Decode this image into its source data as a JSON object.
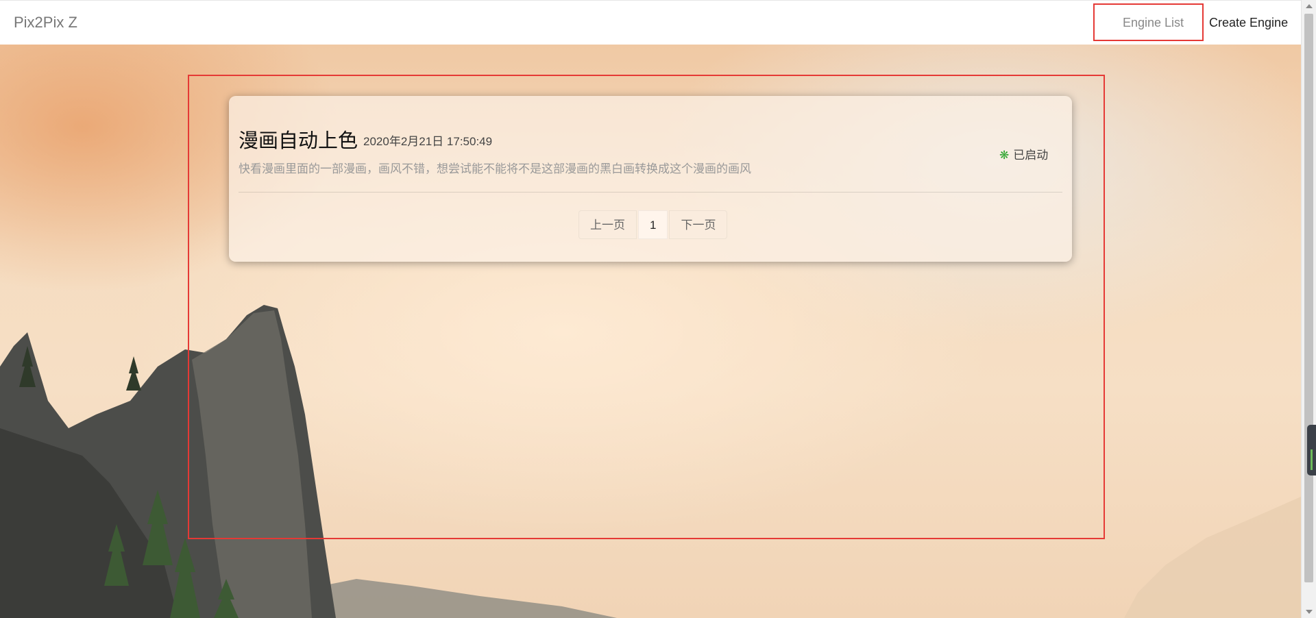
{
  "navbar": {
    "brand": "Pix2Pix Z",
    "links": {
      "engine_list": "Engine List",
      "create_engine": "Create Engine"
    }
  },
  "engine": {
    "title": "漫画自动上色",
    "date": "2020年2月21日 17:50:49",
    "description": "快看漫画里面的一部漫画，画风不错，想尝试能不能将不是这部漫画的黑白画转换成这个漫画的画风",
    "status": "已启动",
    "status_icon": "gear-icon",
    "status_color": "#2fa52f"
  },
  "pagination": {
    "prev": "上一页",
    "current": "1",
    "next": "下一页"
  },
  "colors": {
    "highlight": "#e53935"
  }
}
